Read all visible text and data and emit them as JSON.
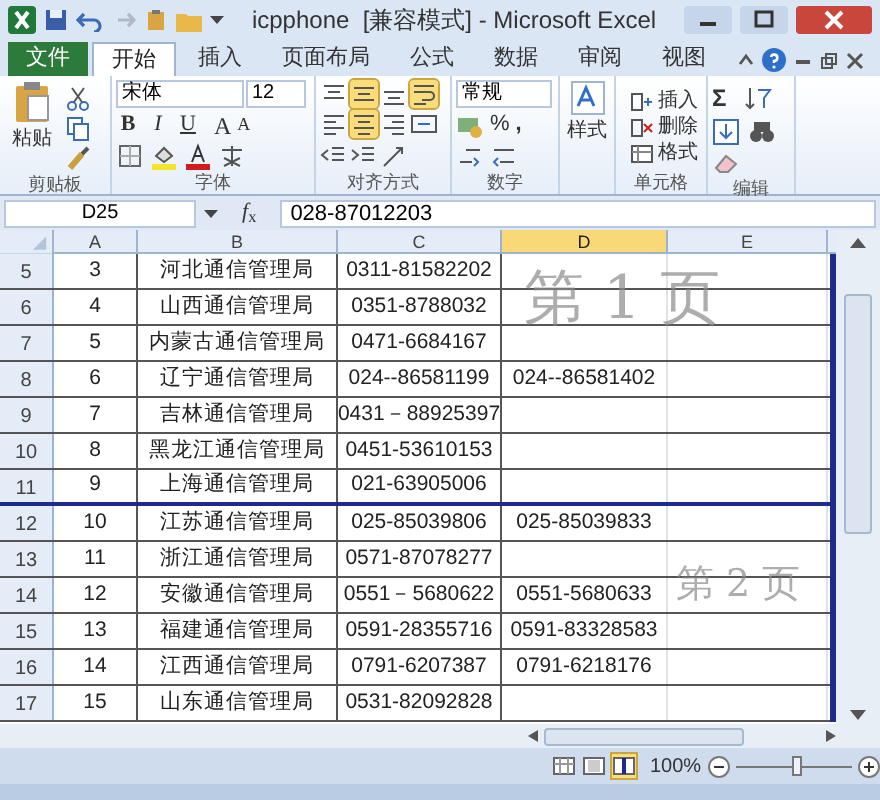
{
  "window": {
    "title": "icpphone  [兼容模式] - Microsoft Excel"
  },
  "ribbon_tabs": [
    {
      "label": "文件",
      "kind": "file",
      "selected": false
    },
    {
      "label": "开始",
      "kind": "tab",
      "selected": true
    },
    {
      "label": "插入",
      "kind": "tab",
      "selected": false
    },
    {
      "label": "页面布局",
      "kind": "tab",
      "selected": false
    },
    {
      "label": "公式",
      "kind": "tab",
      "selected": false
    },
    {
      "label": "数据",
      "kind": "tab",
      "selected": false
    },
    {
      "label": "审阅",
      "kind": "tab",
      "selected": false
    },
    {
      "label": "视图",
      "kind": "tab",
      "selected": false
    }
  ],
  "ribbon_groups": [
    {
      "kind": "clipboard",
      "label": "剪贴板",
      "paste_label": "粘贴"
    },
    {
      "kind": "font",
      "label": "字体",
      "font_name": "宋体",
      "font_size": "12",
      "style_buttons": [
        "B",
        "I",
        "U"
      ],
      "grow_label": "A",
      "shrink_label": "A"
    },
    {
      "kind": "alignment",
      "label": "对齐方式",
      "buttons": [
        {
          "kind": "top",
          "selected": false
        },
        {
          "kind": "middle",
          "selected": true
        },
        {
          "kind": "bottom",
          "selected": false
        },
        {
          "kind": "wrap",
          "selected": true
        },
        {
          "kind": "left",
          "selected": false
        },
        {
          "kind": "center",
          "selected": true
        },
        {
          "kind": "right",
          "selected": false
        },
        {
          "kind": "merge",
          "selected": false
        },
        {
          "kind": "outdent",
          "selected": false
        },
        {
          "kind": "indent",
          "selected": false
        },
        {
          "kind": "orient",
          "selected": false
        }
      ]
    },
    {
      "kind": "number",
      "label": "数字",
      "format": "常规",
      "percent": "%",
      "comma": ","
    },
    {
      "kind": "styles",
      "button_label": "样式"
    },
    {
      "kind": "cells",
      "label": "单元格",
      "buttons": [
        "插入",
        "删除",
        "格式"
      ]
    },
    {
      "kind": "editing",
      "label": "编辑",
      "sum": "Σ"
    }
  ],
  "formula_bar": {
    "name_box": "D25",
    "function_label": "*f*$_{x}$",
    "value": "028-87012203"
  },
  "columns": [
    {
      "label": "A",
      "selected": false
    },
    {
      "label": "B",
      "selected": false
    },
    {
      "label": "C",
      "selected": false
    },
    {
      "label": "D",
      "selected": true
    },
    {
      "label": "E",
      "selected": false
    }
  ],
  "rows": [
    {
      "number": "5",
      "a": "3",
      "b": "河北通信管理局",
      "c": "0311-81582202",
      "page_break_after": false
    },
    {
      "number": "6",
      "a": "4",
      "b": "山西通信管理局",
      "c": "0351-8788032",
      "page_break_after": false
    },
    {
      "number": "7",
      "a": "5",
      "b": "内蒙古通信管理局",
      "c": "0471-6684167",
      "page_break_after": false
    },
    {
      "number": "8",
      "a": "6",
      "b": "辽宁通信管理局",
      "c": "024--86581199",
      "d": "024--86581402",
      "page_break_after": false
    },
    {
      "number": "9",
      "a": "7",
      "b": "吉林通信管理局",
      "c": "0431－88925397",
      "page_break_after": false
    },
    {
      "number": "10",
      "a": "8",
      "b": "黑龙江通信管理局",
      "c": "0451-53610153",
      "page_break_after": false
    },
    {
      "number": "11",
      "a": "9",
      "b": "上海通信管理局",
      "c": "021-63905006",
      "page_break_after": true
    },
    {
      "number": "12",
      "a": "10",
      "b": "江苏通信管理局",
      "c": "025-85039806",
      "d": "025-85039833",
      "page_break_after": false
    },
    {
      "number": "13",
      "a": "11",
      "b": "浙江通信管理局",
      "c": "0571-87078277",
      "page_break_after": false
    },
    {
      "number": "14",
      "a": "12",
      "b": "安徽通信管理局",
      "c": "0551－5680622",
      "d": "0551-5680633",
      "page_break_after": false
    },
    {
      "number": "15",
      "a": "13",
      "b": "福建通信管理局",
      "c": "0591-28355716",
      "d": "0591-83328583",
      "page_break_after": false
    },
    {
      "number": "16",
      "a": "14",
      "b": "江西通信管理局",
      "c": "0791-6207387",
      "d": "0791-6218176",
      "page_break_after": false
    },
    {
      "number": "17",
      "a": "15",
      "b": "山东通信管理局",
      "c": "0531-82092828",
      "page_break_after": false
    }
  ],
  "page_labels": [
    "第 1 页",
    "第 2 页"
  ],
  "status_bar": {
    "views": [
      {
        "kind": "normal",
        "selected": false
      },
      {
        "kind": "layout",
        "selected": false
      },
      {
        "kind": "pagebreak",
        "selected": true
      }
    ],
    "zoom": "100%",
    "zoom_slider": {
      "level": 0.5
    }
  }
}
